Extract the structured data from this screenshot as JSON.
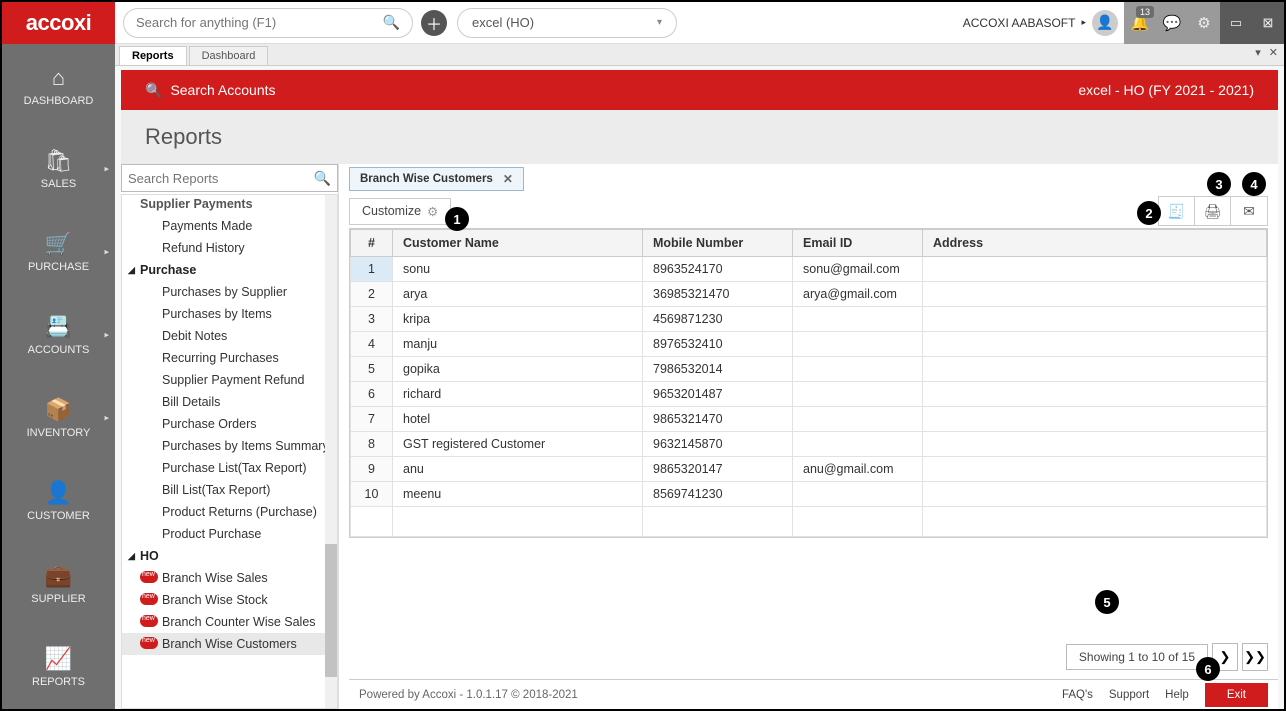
{
  "brand": "accoxi",
  "global_search": {
    "placeholder": "Search for anything (F1)"
  },
  "tenant": {
    "label": "excel (HO)"
  },
  "user": {
    "name": "ACCOXI AABASOFT"
  },
  "notifications": {
    "count": "13"
  },
  "mainnav": [
    {
      "label": "DASHBOARD"
    },
    {
      "label": "SALES"
    },
    {
      "label": "PURCHASE"
    },
    {
      "label": "ACCOUNTS"
    },
    {
      "label": "INVENTORY"
    },
    {
      "label": "CUSTOMER"
    },
    {
      "label": "SUPPLIER"
    },
    {
      "label": "REPORTS"
    }
  ],
  "tabs": {
    "t1": "Reports",
    "t2": "Dashboard"
  },
  "red": {
    "search": "Search Accounts",
    "context": "excel - HO (FY 2021 - 2021)"
  },
  "page_title": "Reports",
  "tree_search": {
    "placeholder": "Search Reports"
  },
  "tree": {
    "top_cut": "Supplier Payments",
    "payments_made": "Payments Made",
    "refund_history": "Refund History",
    "purchase": "Purchase",
    "p_by_supplier": "Purchases by Supplier",
    "p_by_items": "Purchases by Items",
    "debit_notes": "Debit Notes",
    "recurring": "Recurring Purchases",
    "spr": "Supplier Payment Refund",
    "bill_details": "Bill Details",
    "po": "Purchase Orders",
    "p_items_summary": "Purchases by Items Summary",
    "plist_tax": "Purchase List(Tax Report)",
    "blist_tax": "Bill List(Tax Report)",
    "returns": "Product Returns (Purchase)",
    "prod_purchase": "Product Purchase",
    "ho": "HO",
    "ho_sales": "Branch Wise Sales",
    "ho_stock": "Branch Wise Stock",
    "ho_counter": "Branch Counter Wise Sales",
    "ho_customers": "Branch Wise Customers"
  },
  "report_tab": "Branch Wise Customers",
  "customize": "Customize",
  "grid": {
    "cols": {
      "idx": "#",
      "name": "Customer Name",
      "mobile": "Mobile Number",
      "email": "Email ID",
      "addr": "Address"
    },
    "rows": [
      {
        "i": "1",
        "name": "sonu",
        "mobile": "8963524170",
        "email": "sonu@gmail.com",
        "addr": ""
      },
      {
        "i": "2",
        "name": "arya",
        "mobile": "36985321470",
        "email": "arya@gmail.com",
        "addr": ""
      },
      {
        "i": "3",
        "name": "kripa",
        "mobile": "4569871230",
        "email": "",
        "addr": ""
      },
      {
        "i": "4",
        "name": "manju",
        "mobile": "8976532410",
        "email": "",
        "addr": ""
      },
      {
        "i": "5",
        "name": "gopika",
        "mobile": "7986532014",
        "email": "",
        "addr": ""
      },
      {
        "i": "6",
        "name": "richard",
        "mobile": "9653201487",
        "email": "",
        "addr": ""
      },
      {
        "i": "7",
        "name": "hotel",
        "mobile": "9865321470",
        "email": "",
        "addr": ""
      },
      {
        "i": "8",
        "name": "GST registered Customer",
        "mobile": "9632145870",
        "email": "",
        "addr": ""
      },
      {
        "i": "9",
        "name": "anu",
        "mobile": "9865320147",
        "email": "anu@gmail.com",
        "addr": ""
      },
      {
        "i": "10",
        "name": "meenu",
        "mobile": "8569741230",
        "email": "",
        "addr": ""
      }
    ]
  },
  "pager": {
    "text": "Showing 1 to 10 of 15"
  },
  "footer": {
    "powered": "Powered by Accoxi - 1.0.1.17 © 2018-2021",
    "faq": "FAQ's",
    "support": "Support",
    "help": "Help",
    "exit": "Exit"
  },
  "callouts": {
    "c1": "1",
    "c2": "2",
    "c3": "3",
    "c4": "4",
    "c5": "5",
    "c6": "6"
  }
}
